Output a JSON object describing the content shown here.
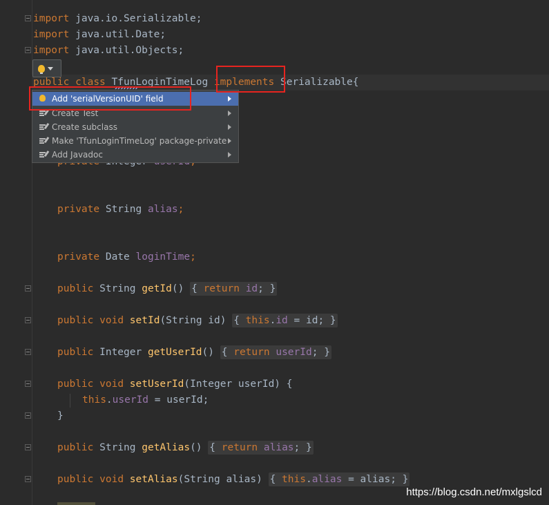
{
  "code": {
    "import1": {
      "kw": "import",
      "rest": " java.io.Serializable;"
    },
    "import2": {
      "kw": "import",
      "rest": " java.util.Date;"
    },
    "import3": {
      "kw": "import",
      "rest": " java.util.Objects;"
    },
    "class_decl": {
      "kw1": "public",
      "kw2": "class",
      "name": "TfunLoginTimeLog",
      "kw3": "implements",
      "iface": "Serializable{"
    },
    "field_userid": {
      "kw": "private",
      "type": " Integer ",
      "name": "userId",
      "end": ";"
    },
    "field_alias": {
      "kw": "private",
      "type": " String ",
      "name": "alias",
      "end": ";"
    },
    "field_logintime": {
      "kw": "private",
      "type": " Date ",
      "name": "loginTime",
      "end": ";"
    },
    "getId": {
      "kw": "public",
      "type": " String ",
      "fn": "getId",
      "params": "() ",
      "ob": "{ ",
      "kw2": "return",
      "sp": " ",
      "fld": "id",
      "end": "; }"
    },
    "setId": {
      "kw": "public",
      "kw_void": "void",
      "fn": "setId",
      "params": "(String id) ",
      "ob": "{ ",
      "kw2": "this",
      "dot": ".",
      "fld": "id",
      "rest": " = id",
      "end": "; }"
    },
    "getUserId": {
      "kw": "public",
      "type": " Integer ",
      "fn": "getUserId",
      "params": "() ",
      "ob": "{ ",
      "kw2": "return",
      "sp": " ",
      "fld": "userId",
      "end": "; }"
    },
    "setUserId": {
      "kw": "public",
      "kw_void": "void",
      "fn": "setUserId",
      "params": "(Integer userId) {"
    },
    "setUserId_body": {
      "kw": "this",
      "dot": ".",
      "fld": "userId",
      "rest": " = userId;"
    },
    "close_brace": "}",
    "getAlias": {
      "kw": "public",
      "type": " String ",
      "fn": "getAlias",
      "params": "() ",
      "ob": "{ ",
      "kw2": "return",
      "sp": " ",
      "fld": "alias",
      "end": "; }"
    },
    "setAlias": {
      "kw": "public",
      "kw_void": "void",
      "fn": "setAlias",
      "params": "(String alias) ",
      "ob": "{ ",
      "kw2": "this",
      "dot": ".",
      "fld": "alias",
      "rest": " = alias",
      "end": "; }"
    }
  },
  "intention_popup": {
    "items": [
      {
        "label": "Add 'serialVersionUID' field",
        "icon": "bulb-icon",
        "selected": true
      },
      {
        "label": "Create Test",
        "icon": "edit-fix-icon"
      },
      {
        "label": "Create subclass",
        "icon": "edit-fix-icon"
      },
      {
        "label": "Make 'TfunLoginTimeLog' package-private",
        "icon": "edit-fix-icon"
      },
      {
        "label": "Add Javadoc",
        "icon": "edit-fix-icon"
      }
    ]
  },
  "watermark": "https://blog.csdn.net/mxlgslcd",
  "colors": {
    "background": "#2b2b2b",
    "keyword": "#cc7832",
    "field": "#9876aa",
    "method": "#ffc66d",
    "text": "#a9b7c6",
    "selection": "#4b6eaf",
    "annotation_box": "#e8241f"
  }
}
